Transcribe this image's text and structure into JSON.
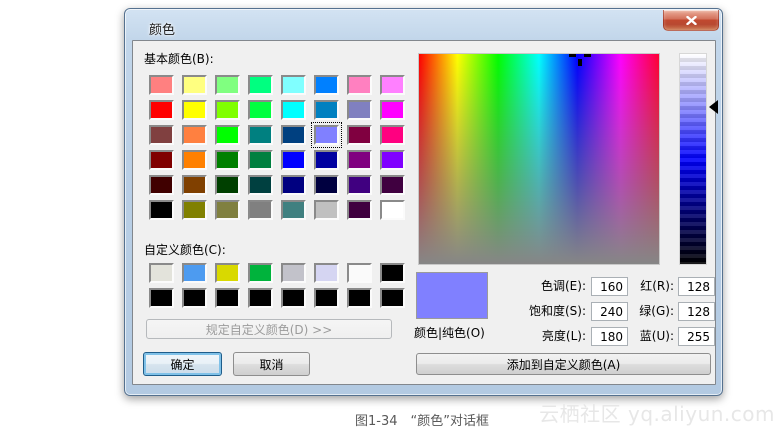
{
  "window": {
    "title": "颜色"
  },
  "basic_colors": {
    "label": "基本颜色(B):",
    "rows": [
      [
        "#FF8080",
        "#FFFF80",
        "#80FF80",
        "#00FF80",
        "#80FFFF",
        "#0080FF",
        "#FF80C0",
        "#FF80FF"
      ],
      [
        "#FF0000",
        "#FFFF00",
        "#80FF00",
        "#00FF40",
        "#00FFFF",
        "#0080C0",
        "#8080C0",
        "#FF00FF"
      ],
      [
        "#804040",
        "#FF8040",
        "#00FF00",
        "#008080",
        "#004080",
        "#8080FF",
        "#800040",
        "#FF0080"
      ],
      [
        "#800000",
        "#FF8000",
        "#008000",
        "#008040",
        "#0000FF",
        "#0000A0",
        "#800080",
        "#8000FF"
      ],
      [
        "#400000",
        "#804000",
        "#004000",
        "#004040",
        "#000080",
        "#000040",
        "#400080",
        "#400040"
      ],
      [
        "#000000",
        "#808000",
        "#808040",
        "#808080",
        "#408080",
        "#C0C0C0",
        "#400040",
        "#FFFFFF"
      ]
    ],
    "selected_cell": {
      "row": 2,
      "col": 5
    }
  },
  "custom_colors": {
    "label": "自定义颜色(C):",
    "rows": [
      [
        "#E3E3DB",
        "#4D9BF0",
        "#D9D900",
        "#00B33C",
        "#C2C2CA",
        "#D5D5F2",
        "#FAFAFA",
        "#000000"
      ],
      [
        "#000000",
        "#000000",
        "#000000",
        "#000000",
        "#000000",
        "#000000",
        "#000000",
        "#000000"
      ]
    ]
  },
  "buttons": {
    "define_custom": "规定自定义颜色(D) >>",
    "ok": "确定",
    "cancel": "取消",
    "add_custom": "添加到自定义颜色(A)"
  },
  "color_mixer": {
    "preview_color": "#8080FF",
    "preview_label": "颜色|纯色(O)",
    "hue": {
      "label": "色调(E):",
      "value": "160"
    },
    "sat": {
      "label": "饱和度(S):",
      "value": "240"
    },
    "lum": {
      "label": "亮度(L):",
      "value": "180"
    },
    "red": {
      "label": "红(R):",
      "value": "128"
    },
    "green": {
      "label": "绿(G):",
      "value": "128"
    },
    "blue": {
      "label": "蓝(U):",
      "value": "255"
    }
  },
  "caption": {
    "text": "图1-34　“颜色”对话框"
  },
  "watermark": {
    "text": "云栖社区 yq.aliyun.com"
  }
}
